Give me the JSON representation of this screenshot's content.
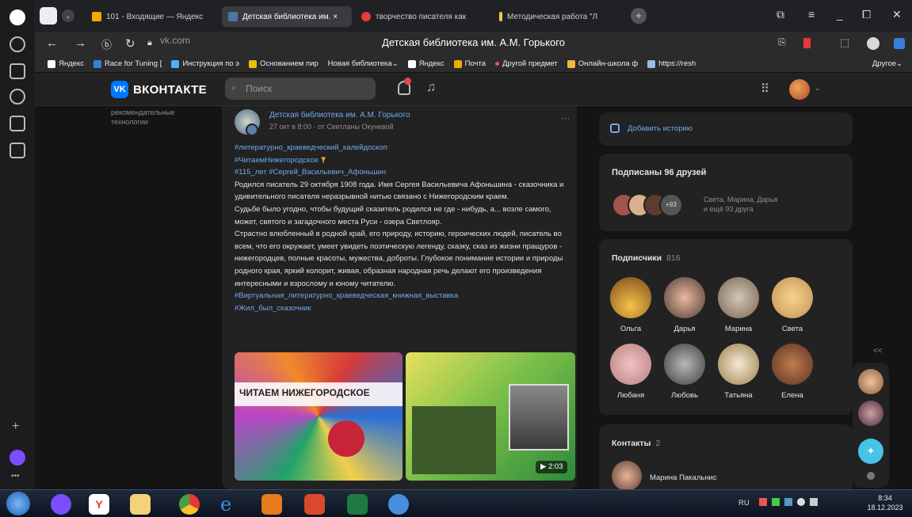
{
  "browser": {
    "tabs": [
      {
        "label": "101 - Входящие — Яндекс",
        "color": "#f2a900"
      },
      {
        "label": "Детская библиотека им. ×",
        "color": "#4a76a8"
      },
      {
        "label": "творчество писателя как",
        "color": "#e83b3b"
      },
      {
        "label": "Методическая работа \"Л",
        "color": "#f2c94c"
      }
    ],
    "address": "vk.com",
    "page_title": "Детская библиотека им. А.М. Горького",
    "bookmarks": [
      "Яндекс",
      "Race for Tuning [",
      "Инструкция по э",
      "Основанием пир",
      "Новая библиотека",
      "Яндекс",
      "Почта",
      "Другой предмет",
      "Онлайн-школа ф",
      "https://resh",
      "Другое"
    ]
  },
  "vk": {
    "logo_text": "ВКОНТАКТЕ",
    "logo_mark": "VK",
    "search_placeholder": "Поиск",
    "sidebar_text": "рекомендательные технологии"
  },
  "post": {
    "author": "Детская библиотека им. А.М. Горького",
    "meta": "27 окт в 8:00 · от Светланы Окуневой",
    "menu": "···",
    "tags1": "#литературно_краеведческий_калейдоскоп",
    "tags2": "#ЧитаемНижегородское",
    "tags3": "#115_лет #Сергей_Васильевич_Афоньшин",
    "para1": "Родился писатель 29 октября 1908 года. Имя Сергея Васильевича Афоньшина - сказочника и удивительного писателя неразрывной нитью связано с Нижегородским краем.",
    "para2": "Судьбе было угодно, чтобы будущий сказитель родился не где - нибудь, а... возле самого, может, святого и загадочного места Руси - озера Светлояр.",
    "para3": "Страстно влюбленный в родной край, его природу, историю, героических людей, писатель во всем, что его окружает, умеет увидеть поэтическую легенду, сказку, сказ из жизни пращуров - нижегородцев, полные красоты, мужества, доброты. Глубокое понимание истории и природы родного края, яркий колорит, живая, образная народная речь делают его произведения интересными и взрослому и юному читателю.",
    "tags4": "#Виртуальная_литературно_краеведческая_книжная_выставка",
    "tags5": "#Жил_был_сказочник",
    "image1_title": "ЧИТАЕМ НИЖЕГОРОДСКОЕ",
    "video_duration": "2:03"
  },
  "right": {
    "add_story": "Добавить историю",
    "friends_title": "Подписаны 96 друзей",
    "friends_more": "+93",
    "friends_names": "Света, Марина, Дарья",
    "friends_rest": "и ещё 93 друга",
    "subscribers_title": "Подписчики",
    "subscribers_count": "816",
    "subscribers": [
      "Ольга",
      "Дарья",
      "Марина",
      "Света",
      "Любаня",
      "Любовь",
      "Татьяна",
      "Елена"
    ],
    "contacts_title": "Контакты",
    "contacts_count": "2",
    "contact_name": "Марина Пакальнис",
    "collapse": "<<"
  },
  "taskbar": {
    "lang": "RU",
    "time": "8:34",
    "date": "18.12.2023"
  }
}
